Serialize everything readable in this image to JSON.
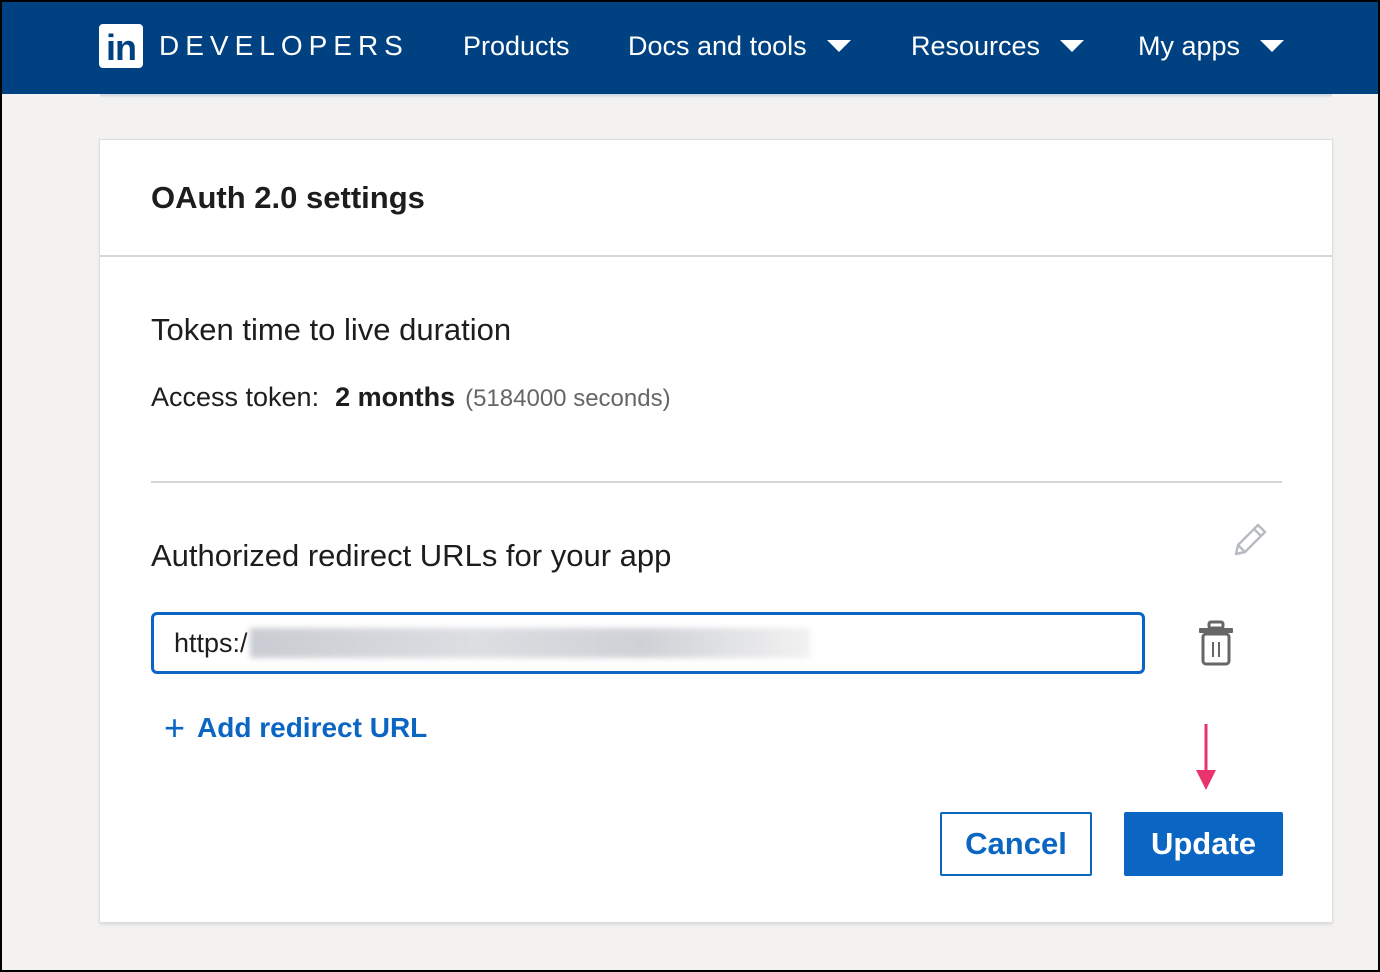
{
  "header": {
    "logo_text": "in",
    "brand": "DEVELOPERS",
    "nav": {
      "products": "Products",
      "docs": "Docs and tools",
      "resources": "Resources",
      "my_apps": "My apps"
    }
  },
  "card": {
    "title": "OAuth 2.0 settings",
    "token": {
      "heading": "Token time to live duration",
      "label": "Access token:",
      "value": "2 months",
      "seconds": "(5184000 seconds)"
    },
    "redirect": {
      "heading": "Authorized redirect URLs for your app",
      "url_value": "https:/",
      "add_label": "Add redirect URL"
    },
    "buttons": {
      "cancel": "Cancel",
      "update": "Update"
    }
  },
  "colors": {
    "header_bg": "#004182",
    "primary": "#0a66c2",
    "annotation_arrow": "#e8336b"
  },
  "icons": {
    "edit": "pencil-icon",
    "delete": "trash-icon",
    "add": "plus-icon",
    "dropdown": "caret-down-icon"
  }
}
